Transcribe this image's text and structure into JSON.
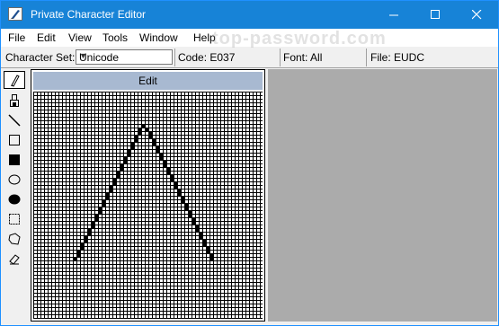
{
  "window": {
    "title": "Private Character Editor",
    "watermark": "top-password.com"
  },
  "menu": [
    "File",
    "Edit",
    "View",
    "Tools",
    "Window",
    "Help"
  ],
  "charbar": {
    "charset_label": "Character Set:",
    "charset_value": "Unicode",
    "code": "Code: E037",
    "font": "Font: All",
    "file": "File: EUDC"
  },
  "tools": [
    {
      "name": "pencil-icon"
    },
    {
      "name": "brush-icon"
    },
    {
      "name": "line-icon"
    },
    {
      "name": "hollow-rectangle-icon"
    },
    {
      "name": "filled-rectangle-icon"
    },
    {
      "name": "hollow-ellipse-icon"
    },
    {
      "name": "filled-ellipse-icon"
    },
    {
      "name": "rectangular-selection-icon"
    },
    {
      "name": "freeform-selection-icon"
    },
    {
      "name": "eraser-icon"
    }
  ],
  "edit_panel": {
    "header": "Edit"
  },
  "colors": {
    "titlebar": "#1783d7",
    "edit_header": "#a8b9d1",
    "reference_area": "#ababab"
  }
}
